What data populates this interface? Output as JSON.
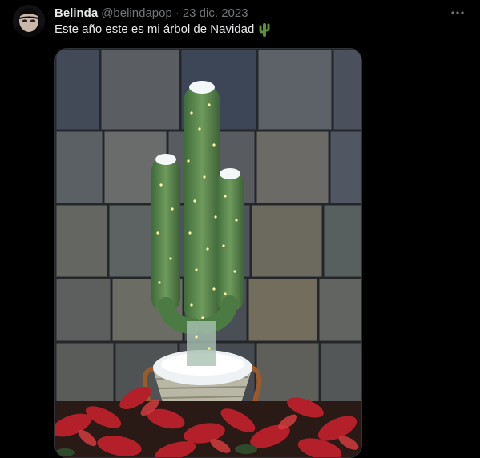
{
  "tweet": {
    "display_name": "Belinda",
    "handle": "@belindapop",
    "separator": "·",
    "date": "23 dic. 2023",
    "text": "Este año este es mi árbol de Navidad",
    "emoji": "cactus-emoji",
    "avatar_icon": "avatar-photo",
    "more_icon": "more-horizontal-icon",
    "media_icon": "photo-cactus-christmas-lights"
  },
  "colors": {
    "background": "#000000",
    "primary_text": "#e7e9ea",
    "secondary_text": "#71767b",
    "media_border": "#2f3336"
  }
}
